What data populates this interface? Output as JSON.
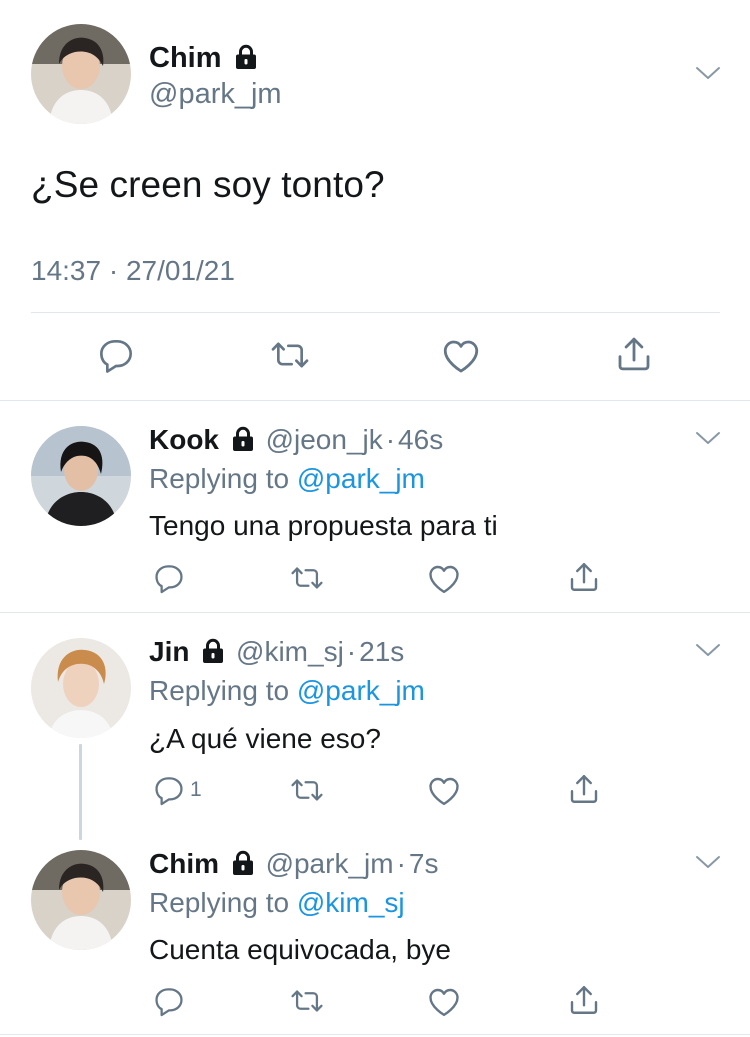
{
  "main_tweet": {
    "display_name": "Chim",
    "handle": "@park_jm",
    "text": "¿Se creen soy tonto?",
    "timestamp": "14:37 · 27/01/21",
    "protected": true,
    "avatar": "person-photo-icon"
  },
  "replies": [
    {
      "display_name": "Kook",
      "handle": "@jeon_jk",
      "separator": "·",
      "age": "46s",
      "replying_prefix": "Replying to",
      "replying_to": "@park_jm",
      "text": "Tengo una propuesta para ti",
      "reply_count": "",
      "protected": true
    },
    {
      "display_name": "Jin",
      "handle": "@kim_sj",
      "separator": "·",
      "age": "21s",
      "replying_prefix": "Replying to",
      "replying_to": "@park_jm",
      "text": "¿A qué viene eso?",
      "reply_count": "1",
      "protected": true
    },
    {
      "display_name": "Chim",
      "handle": "@park_jm",
      "separator": "·",
      "age": "7s",
      "replying_prefix": "Replying to",
      "replying_to": "@kim_sj",
      "text": "Cuenta equivocada, bye",
      "reply_count": "",
      "protected": true
    }
  ],
  "colors": {
    "text": "#14171a",
    "muted": "#657786",
    "link": "#1b95e0",
    "divider": "#e1e8ed",
    "thread_line": "#ccd6dd"
  },
  "icons": [
    "reply-icon",
    "retweet-icon",
    "like-icon",
    "share-icon",
    "chevron-down-icon",
    "lock-icon"
  ]
}
